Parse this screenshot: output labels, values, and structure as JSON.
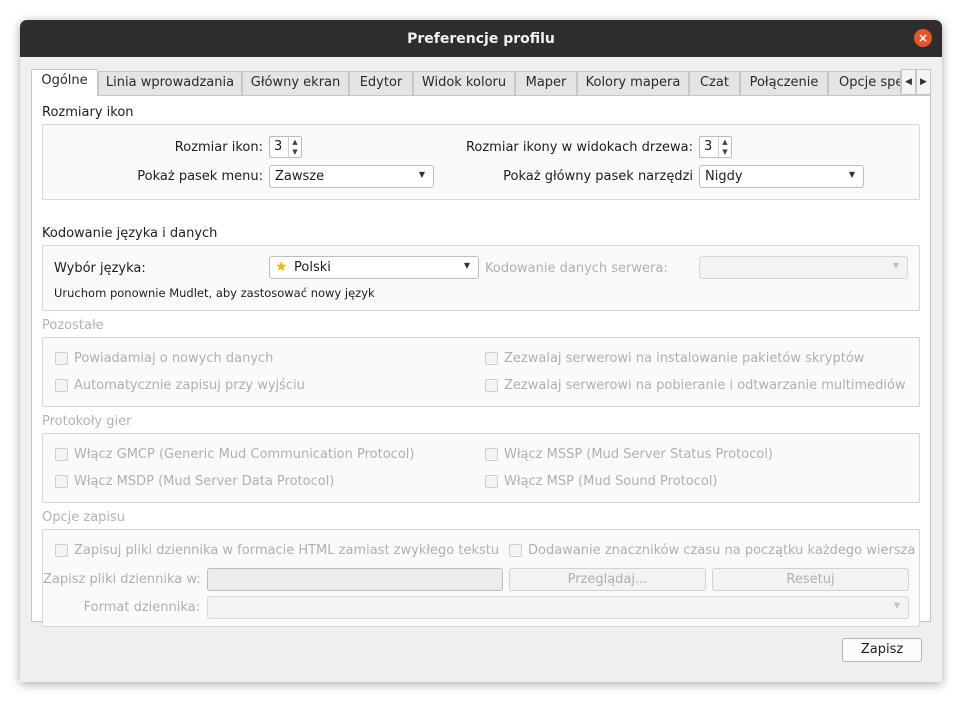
{
  "window": {
    "title": "Preferencje profilu",
    "close_icon": "×"
  },
  "tabs": [
    {
      "label": "Ogólne"
    },
    {
      "label": "Linia wprowadzania"
    },
    {
      "label": "Główny ekran"
    },
    {
      "label": "Edytor"
    },
    {
      "label": "Widok koloru"
    },
    {
      "label": "Maper"
    },
    {
      "label": "Kolory mapera"
    },
    {
      "label": "Czat"
    },
    {
      "label": "Połączenie"
    },
    {
      "label": "Opcje spec"
    }
  ],
  "tab_scroll": {
    "left": "◀",
    "right": "▶"
  },
  "icons_section": {
    "title": "Rozmiary ikon",
    "icon_size_label": "Rozmiar ikon:",
    "icon_size_value": "3",
    "tree_icon_size_label": "Rozmiar ikony w widokach drzewa:",
    "tree_icon_size_value": "3",
    "menu_bar_label": "Pokaż pasek menu:",
    "menu_bar_value": "Zawsze",
    "toolbar_label": "Pokaż główny pasek narzędzi",
    "toolbar_value": "Nigdy"
  },
  "language_section": {
    "title": "Kodowanie języka i danych",
    "language_label": "Wybór języka:",
    "language_value": "Polski",
    "encoding_label": "Kodowanie danych serwera:",
    "encoding_value": "",
    "restart_note": "Uruchom ponownie Mudlet, aby zastosować nowy język"
  },
  "other_section": {
    "title": "Pozostałe",
    "notify_new_data": "Powiadamiaj o nowych danych",
    "autosave_on_exit": "Automatycznie zapisuj przy wyjściu",
    "allow_install_packages": "Zezwalaj serwerowi na instalowanie pakietów skryptów",
    "allow_media": "Zezwalaj serwerowi na pobieranie i odtwarzanie multimediów"
  },
  "protocols_section": {
    "title": "Protokoły gier",
    "gmcp": "Włącz GMCP (Generic Mud Communication Protocol)",
    "mssp": "Włącz MSSP (Mud Server Status Protocol)",
    "msdp": "Włącz MSDP (Mud Server Data Protocol)",
    "msp": "Włącz MSP (Mud Sound Protocol)"
  },
  "log_section": {
    "title": "Opcje zapisu",
    "html_logs": "Zapisuj pliki dziennika w formacie HTML zamiast zwykłego tekstu",
    "timestamps": "Dodawanie znaczników czasu na początku każdego wiersza",
    "save_dir_label": "Zapisz pliki dziennika w:",
    "save_dir_value": "",
    "browse_button": "Przeglądaj...",
    "reset_button": "Resetuj",
    "log_format_label": "Format dziennika:",
    "log_format_value": ""
  },
  "footer": {
    "save_button": "Zapisz"
  },
  "colors": {
    "titlebar": "#2e2e2e",
    "close": "#e9542b",
    "disabled_text": "#b0b0b0"
  }
}
